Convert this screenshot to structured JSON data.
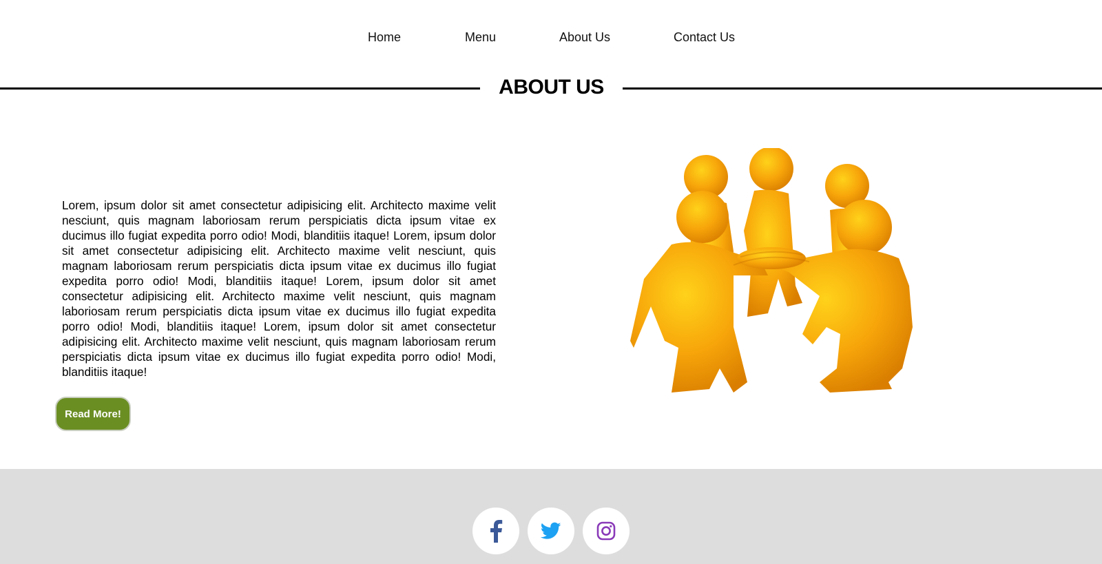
{
  "nav": {
    "items": [
      {
        "label": "Home"
      },
      {
        "label": "Menu"
      },
      {
        "label": "About Us"
      },
      {
        "label": "Contact Us"
      }
    ]
  },
  "section": {
    "title": "ABOUT US"
  },
  "about": {
    "paragraph": "Lorem, ipsum dolor sit amet consectetur adipisicing elit. Architecto maxime velit nesciunt, quis magnam laboriosam rerum perspiciatis dicta ipsum vitae ex ducimus illo fugiat expedita porro odio! Modi, blanditiis itaque! Lorem, ipsum dolor sit amet consectetur adipisicing elit. Architecto maxime velit nesciunt, quis magnam laboriosam rerum perspiciatis dicta ipsum vitae ex ducimus illo fugiat expedita porro odio! Modi, blanditiis itaque! Lorem, ipsum dolor sit amet consectetur adipisicing elit. Architecto maxime velit nesciunt, quis magnam laboriosam rerum perspiciatis dicta ipsum vitae ex ducimus illo fugiat expedita porro odio! Modi, blanditiis itaque! Lorem, ipsum dolor sit amet consectetur adipisicing elit. Architecto maxime velit nesciunt, quis magnam laboriosam rerum perspiciatis dicta ipsum vitae ex ducimus illo fugiat expedita porro odio! Modi, blanditiis itaque!",
    "button_label": "Read More!"
  },
  "footer": {
    "social": [
      {
        "icon": "facebook-icon",
        "color": "#3b5998"
      },
      {
        "icon": "twitter-icon",
        "color": "#1da1f2"
      },
      {
        "icon": "instagram-icon",
        "color": "#8a3ab9"
      }
    ]
  },
  "colors": {
    "accent_button": "#6b8e23",
    "footer_bg": "#dddddd",
    "figure_orange": "#f7a50a"
  }
}
